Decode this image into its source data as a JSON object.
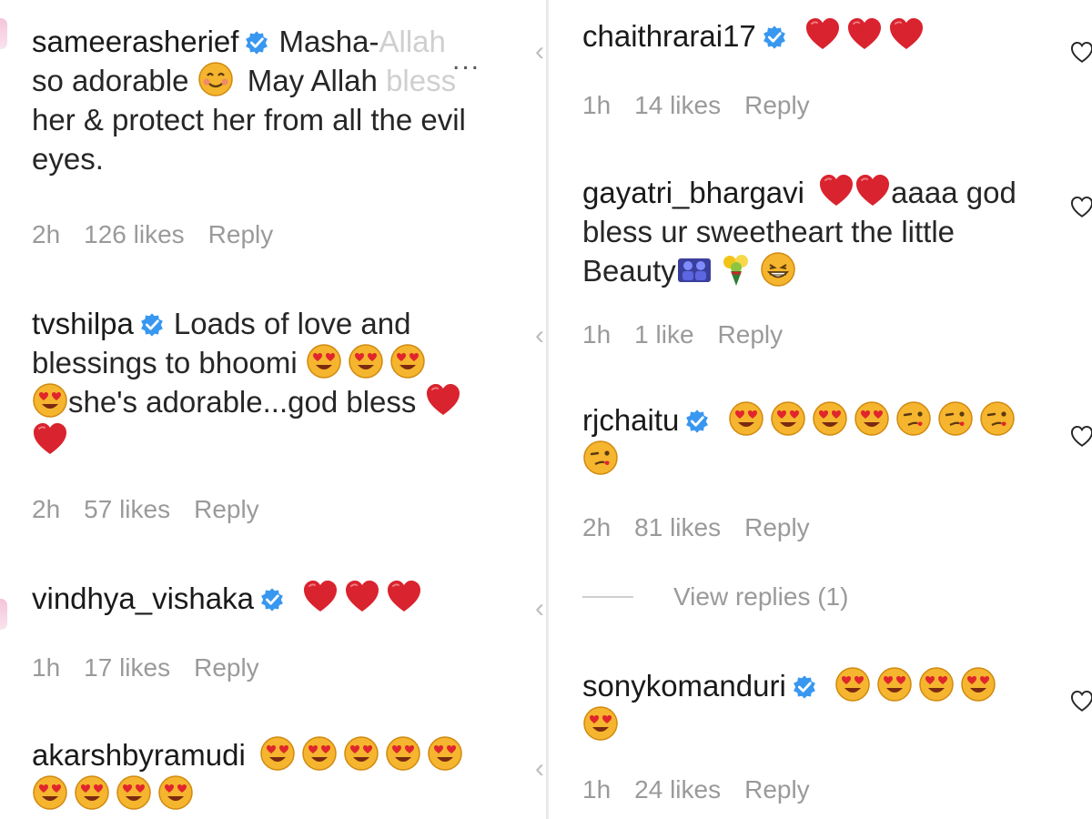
{
  "colors": {
    "verified": "#3897f0",
    "heart": "#d9232e",
    "meta": "#9a9a9a"
  },
  "left_column": [
    {
      "username": "sameerasherief",
      "verified": true,
      "text_before": "Masha-",
      "text_faded_1": "Allah",
      "text_line2": "so adorable",
      "text_after_emoji": " May Allah ",
      "text_faded_2": "bless",
      "text_rest": "her & protect her from all the evil eyes.",
      "time": "2h",
      "likes": "126 likes",
      "reply": "Reply"
    },
    {
      "username": "tvshilpa",
      "verified": true,
      "text": "Loads of love and blessings to bhoomi",
      "text_2": "she's adorable...god bless",
      "time": "2h",
      "likes": "57 likes",
      "reply": "Reply"
    },
    {
      "username": "vindhya_vishaka",
      "verified": true,
      "time": "1h",
      "likes": "17 likes",
      "reply": "Reply"
    },
    {
      "username": "akarshbyramudi",
      "verified": false
    }
  ],
  "right_column": [
    {
      "username": "chaithrarai17",
      "verified": true,
      "time": "1h",
      "likes": "14 likes",
      "reply": "Reply"
    },
    {
      "username": "gayatri_bhargavi",
      "verified": false,
      "text": "aaaa god bless ur sweetheart the little Beauty",
      "time": "1h",
      "likes": "1 like",
      "reply": "Reply"
    },
    {
      "username": "rjchaitu",
      "verified": true,
      "time": "2h",
      "likes": "81 likes",
      "reply": "Reply",
      "view_replies": "View replies (1)"
    },
    {
      "username": "sonykomanduri",
      "verified": true,
      "time": "1h",
      "likes": "24 likes",
      "reply": "Reply"
    }
  ],
  "more_label": "..."
}
